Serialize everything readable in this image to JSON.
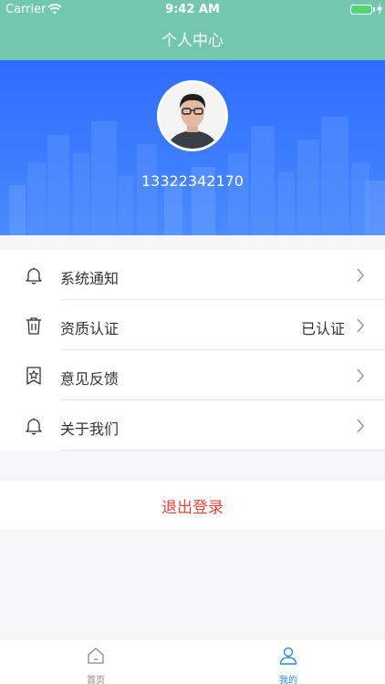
{
  "status_bar": {
    "carrier": "Carrier",
    "time": "9:42 AM"
  },
  "nav": {
    "title": "个人中心"
  },
  "profile": {
    "phone": "13322342170"
  },
  "menu": [
    {
      "label": "系统通知",
      "value": "",
      "icon": "bell-icon"
    },
    {
      "label": "资质认证",
      "value": "已认证",
      "icon": "trash-icon"
    },
    {
      "label": "意见反馈",
      "value": "",
      "icon": "bookmark-star-icon"
    },
    {
      "label": "关于我们",
      "value": "",
      "icon": "bell-icon"
    }
  ],
  "logout_label": "退出登录",
  "tabbar": [
    {
      "label": "首页",
      "icon": "home-icon",
      "active": false
    },
    {
      "label": "我的",
      "icon": "user-icon",
      "active": true
    }
  ],
  "colors": {
    "nav_bg": "#72c7ae",
    "banner_blue": "#2f6dff",
    "logout_red": "#e8433c",
    "tab_active": "#2a8bd8"
  }
}
